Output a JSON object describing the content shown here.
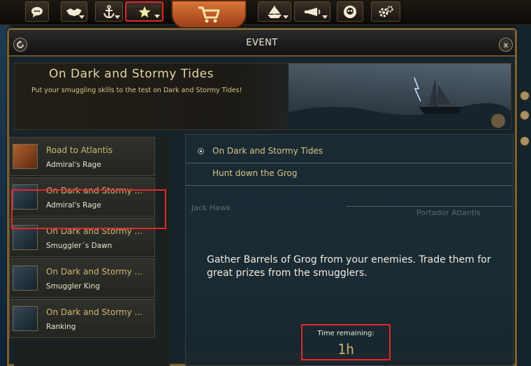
{
  "toolbar": {
    "buttons": [
      {
        "name": "chat",
        "icon": "chat-bubble-icon"
      },
      {
        "name": "trade",
        "icon": "handshake-icon"
      },
      {
        "name": "anchor",
        "icon": "anchor-icon"
      },
      {
        "name": "favorites",
        "icon": "star-icon"
      },
      {
        "name": "shop",
        "icon": "shopping-cart-icon"
      },
      {
        "name": "fleet",
        "icon": "ship-icon"
      },
      {
        "name": "horn",
        "icon": "horn-icon"
      },
      {
        "name": "skull",
        "icon": "skull-icon"
      },
      {
        "name": "settings",
        "icon": "gear-icon"
      }
    ]
  },
  "window": {
    "title": "EVENT",
    "refresh_icon": "refresh-icon",
    "close_icon": "close-icon",
    "close_label": "x"
  },
  "banner": {
    "title": "On Dark and Stormy Tides",
    "subtitle": "Put your smuggling skills to the test on Dark and Stormy Tides!"
  },
  "event_list": [
    {
      "title": "Road to Atlantis",
      "subtitle": "Admiral's Rage"
    },
    {
      "title": "On Dark and Stormy ...",
      "subtitle": "Admiral's Rage"
    },
    {
      "title": "On Dark and Stormy ...",
      "subtitle": "Smuggler´s Dawn"
    },
    {
      "title": "On Dark and Stormy ...",
      "subtitle": "Smuggler King"
    },
    {
      "title": "On Dark and Stormy ...",
      "subtitle": "Ranking"
    }
  ],
  "content": {
    "selected_event": "On Dark and Stormy Tides",
    "task": "Hunt down the Grog",
    "background_labels": [
      "Jack Hawk",
      "Portador Atlantis"
    ],
    "description": "Gather Barrels of Grog from your enemies. Trade them for great prizes from the smugglers.",
    "time_remaining_label": "Time remaining:",
    "time_remaining_value": "1h"
  },
  "colors": {
    "frame_gold": "#7a6338",
    "highlight_red": "#e3262c",
    "title_gold": "#e3d6a3",
    "item_title_gold": "#cdb771"
  }
}
